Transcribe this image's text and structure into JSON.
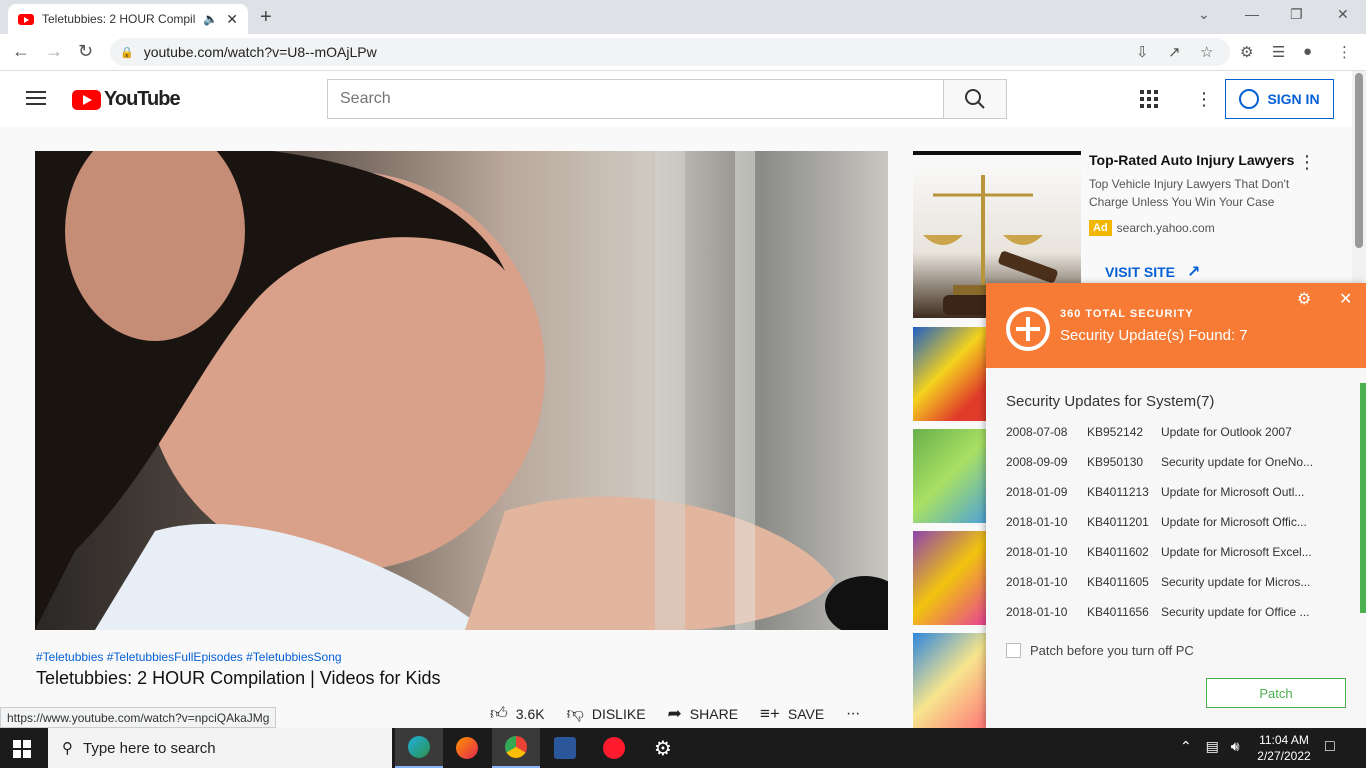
{
  "browser": {
    "tab_title": "Teletubbies: 2 HOUR Compil",
    "url": "youtube.com/watch?v=U8--mOAjLPw",
    "status_url": "https://www.youtube.com/watch?v=npciQAkaJMg"
  },
  "youtube": {
    "logo_text": "YouTube",
    "search_placeholder": "Search",
    "signin_label": "SIGN IN"
  },
  "video": {
    "hashtags": "#Teletubbies #TeletubbiesFullEpisodes #TeletubbiesSong",
    "title": "Teletubbies: 2 HOUR Compilation | Videos for Kids",
    "actions": {
      "like_count": "3.6K",
      "dislike_label": "DISLIKE",
      "share_label": "SHARE",
      "save_label": "SAVE"
    }
  },
  "ad": {
    "title": "Top-Rated Auto Injury Lawyers",
    "description": "Top Vehicle Injury Lawyers That Don't Charge Unless You Win Your Case",
    "badge": "Ad",
    "domain": "search.yahoo.com",
    "visit_label": "VISIT SITE"
  },
  "security_popup": {
    "brand": "360 TOTAL SECURITY",
    "found_text": "Security Update(s) Found: 7",
    "section_title": "Security Updates for System(7)",
    "updates": [
      {
        "date": "2008-07-08",
        "kb": "KB952142",
        "title": "Update for Outlook 2007"
      },
      {
        "date": "2008-09-09",
        "kb": "KB950130",
        "title": "Security update for OneNo..."
      },
      {
        "date": "2018-01-09",
        "kb": "KB4011213",
        "title": "Update for Microsoft Outl..."
      },
      {
        "date": "2018-01-10",
        "kb": "KB4011201",
        "title": "Update for Microsoft Offic..."
      },
      {
        "date": "2018-01-10",
        "kb": "KB4011602",
        "title": "Update for Microsoft Excel..."
      },
      {
        "date": "2018-01-10",
        "kb": "KB4011605",
        "title": "Security update for Micros..."
      },
      {
        "date": "2018-01-10",
        "kb": "KB4011656",
        "title": "Security update for Office ..."
      }
    ],
    "patch_checkbox_label": "Patch before you turn off PC",
    "patch_button": "Patch",
    "accent_color": "#f77a35",
    "patch_color": "#4caf50"
  },
  "taskbar": {
    "search_placeholder": "Type here to search",
    "time": "11:04 AM",
    "date": "2/27/2022"
  }
}
